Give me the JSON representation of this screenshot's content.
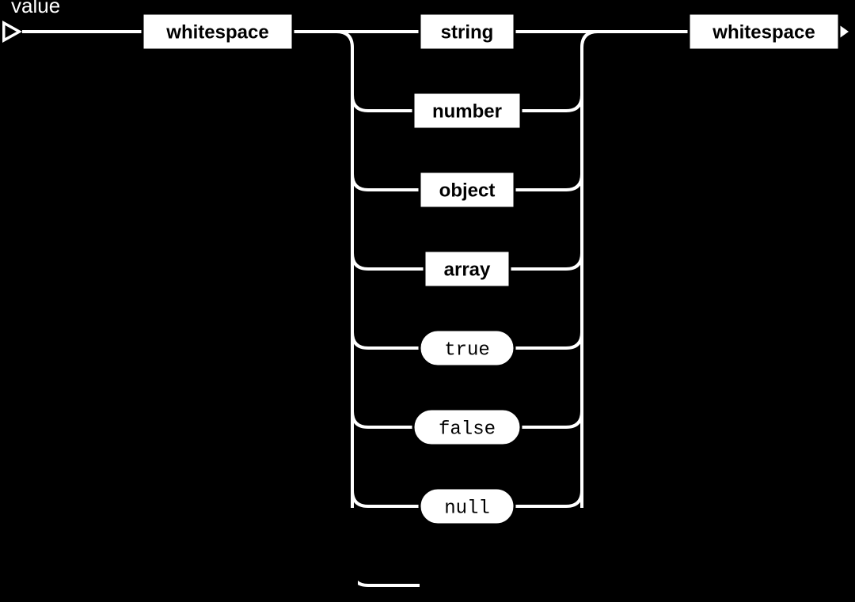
{
  "rule_name": "value",
  "rail": {
    "pre": {
      "label": "whitespace"
    },
    "post": {
      "label": "whitespace"
    }
  },
  "alternatives": [
    {
      "kind": "nonterminal",
      "label": "string"
    },
    {
      "kind": "nonterminal",
      "label": "number"
    },
    {
      "kind": "nonterminal",
      "label": "object"
    },
    {
      "kind": "nonterminal",
      "label": "array"
    },
    {
      "kind": "terminal",
      "label": "true"
    },
    {
      "kind": "terminal",
      "label": "false"
    },
    {
      "kind": "terminal",
      "label": "null"
    }
  ]
}
